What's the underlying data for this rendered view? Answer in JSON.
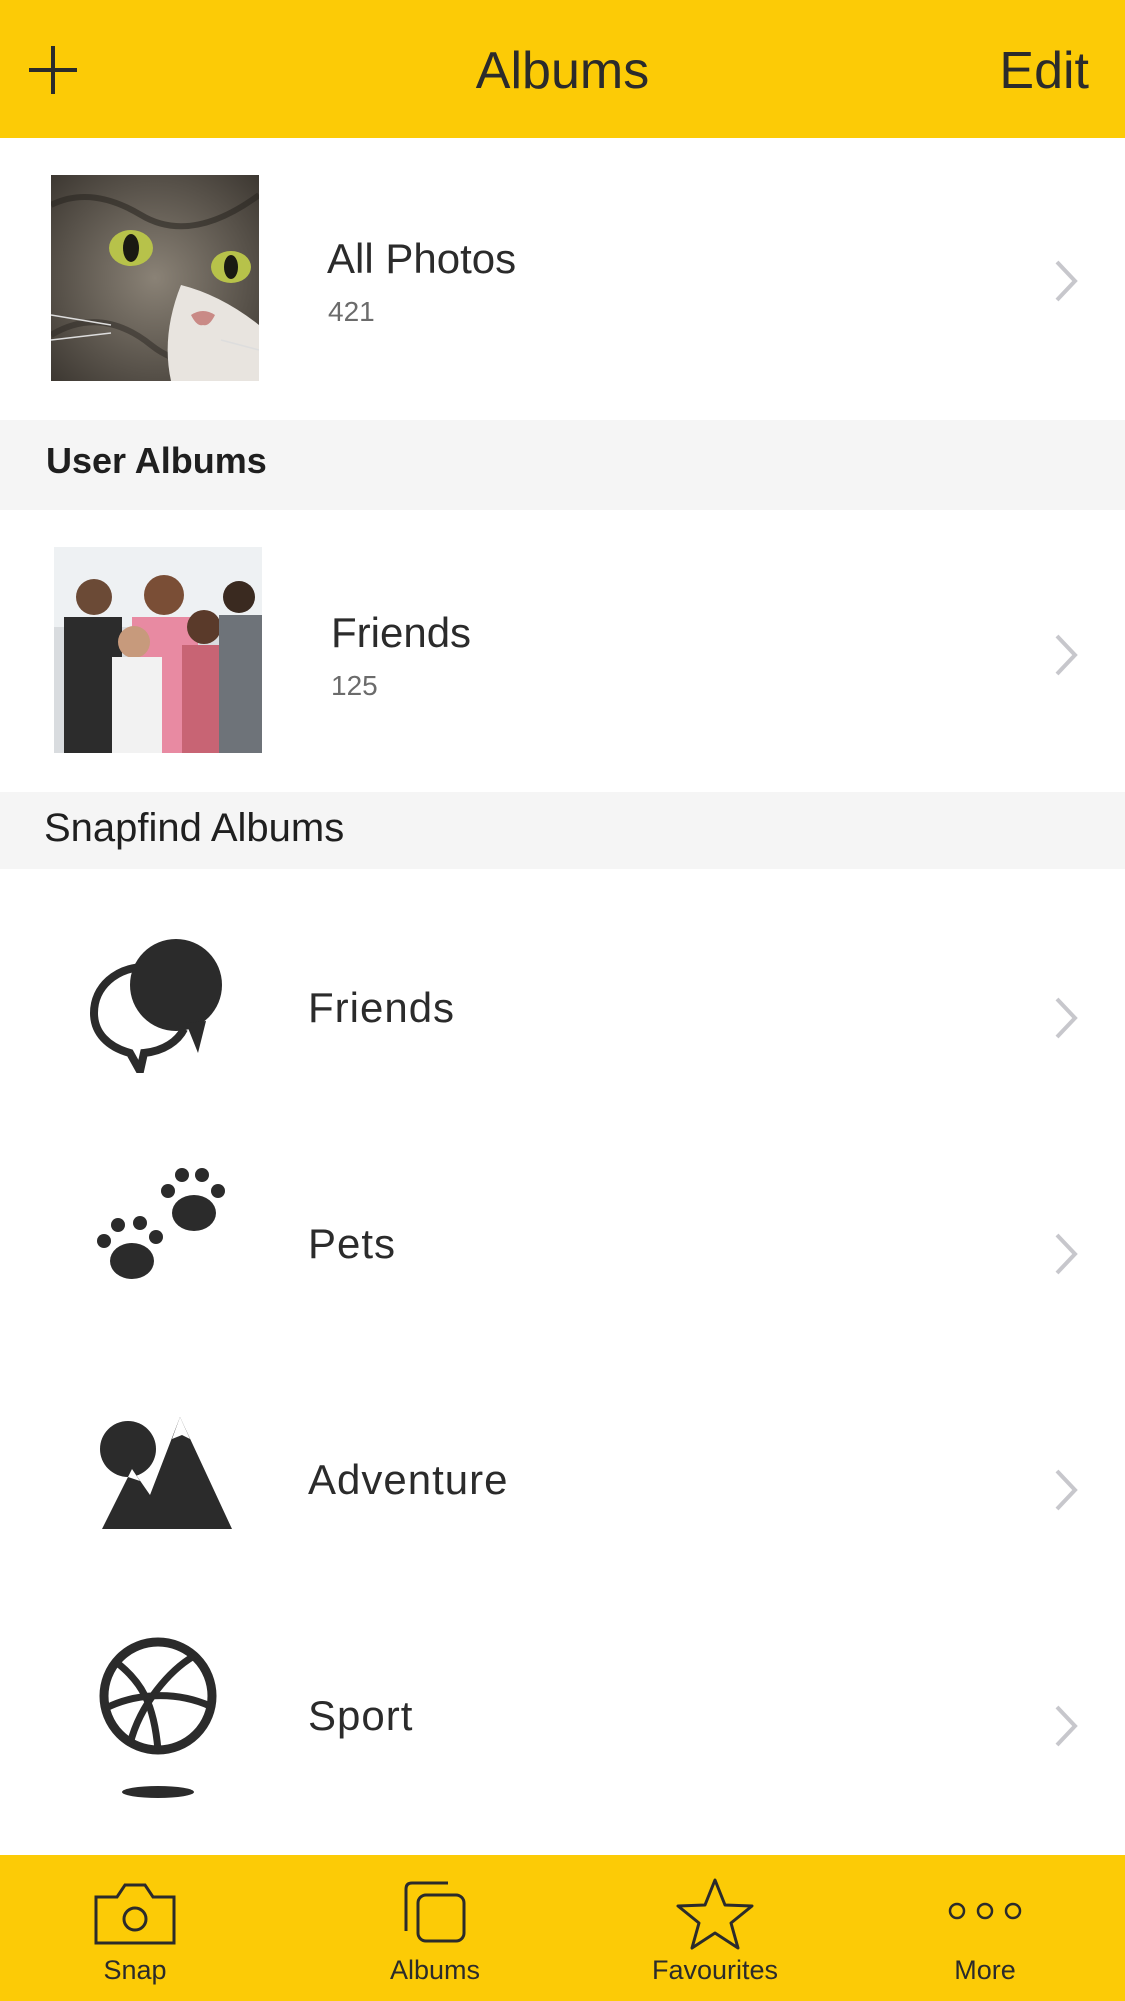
{
  "header": {
    "title": "Albums",
    "edit_label": "Edit",
    "add_icon": "plus-icon"
  },
  "all_photos": {
    "title": "All Photos",
    "count": "421"
  },
  "user_albums": {
    "section_title": "User Albums",
    "items": [
      {
        "title": "Friends",
        "count": "125"
      }
    ]
  },
  "snapfind_albums": {
    "section_title": "Snapfind Albums",
    "items": [
      {
        "title": "Friends",
        "icon": "speech-bubbles-icon"
      },
      {
        "title": "Pets",
        "icon": "paw-prints-icon"
      },
      {
        "title": "Adventure",
        "icon": "mountain-icon"
      },
      {
        "title": "Sport",
        "icon": "basketball-icon"
      }
    ]
  },
  "tabbar": {
    "tabs": [
      {
        "label": "Snap",
        "icon": "camera-icon"
      },
      {
        "label": "Albums",
        "icon": "albums-icon"
      },
      {
        "label": "Favourites",
        "icon": "star-icon"
      },
      {
        "label": "More",
        "icon": "more-dots-icon"
      }
    ]
  },
  "colors": {
    "accent": "#fccb06",
    "section_bg": "#f5f5f5",
    "text": "#2b2b2b",
    "chevron": "#c7c7cc"
  }
}
